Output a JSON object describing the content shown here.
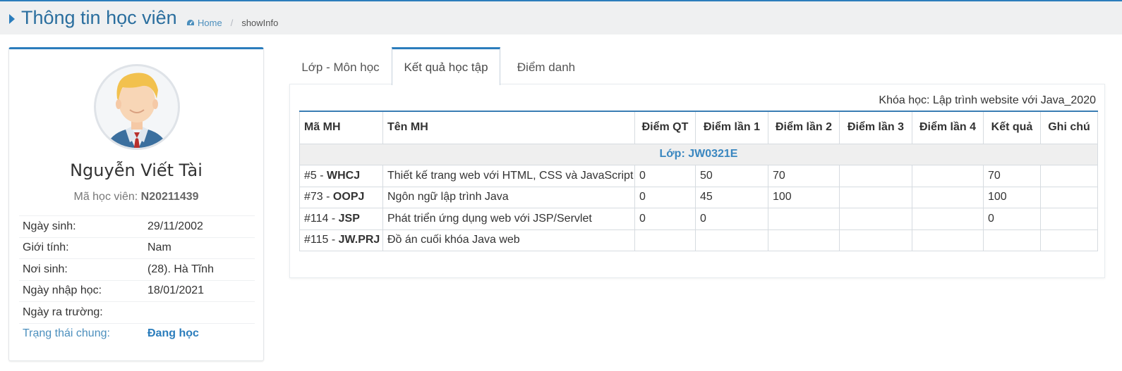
{
  "header": {
    "title": "Thông tin học viên",
    "breadcrumb_home": "Home",
    "breadcrumb_current": "showInfo"
  },
  "profile": {
    "name": "Nguyễn Viết Tài",
    "code_label": "Mã học viên:",
    "code_value": "N20211439",
    "fields": [
      {
        "label": "Ngày sinh:",
        "value": "29/11/2002"
      },
      {
        "label": "Giới tính:",
        "value": "Nam"
      },
      {
        "label": "Nơi sinh:",
        "value": "(28). Hà Tĩnh"
      },
      {
        "label": "Ngày nhập học:",
        "value": "18/01/2021"
      },
      {
        "label": "Ngày ra trường:",
        "value": ""
      },
      {
        "label": "Trạng thái chung:",
        "value": "Đang học"
      }
    ]
  },
  "tabs": [
    {
      "label": "Lớp - Môn học"
    },
    {
      "label": "Kết quả học tập"
    },
    {
      "label": "Điểm danh"
    }
  ],
  "course": "Khóa học: Lập trình website với Java_2020",
  "table": {
    "headers": [
      "Mã MH",
      "Tên MH",
      "Điểm QT",
      "Điểm lần 1",
      "Điểm lần 2",
      "Điểm lần 3",
      "Điểm lần 4",
      "Kết quả",
      "Ghi chú"
    ],
    "group": "Lớp: JW0321E",
    "rows": [
      {
        "id": "#5 - ",
        "code": "WHCJ",
        "name": "Thiết kế trang web với HTML, CSS và JavaScript",
        "qt": "0",
        "l1": "50",
        "l2": "70",
        "l3": "",
        "l4": "",
        "kq": "70",
        "note": ""
      },
      {
        "id": "#73 - ",
        "code": "OOPJ",
        "name": "Ngôn ngữ lập trình Java",
        "qt": "0",
        "l1": "45",
        "l2": "100",
        "l3": "",
        "l4": "",
        "kq": "100",
        "note": ""
      },
      {
        "id": "#114 - ",
        "code": "JSP",
        "name": "Phát triển ứng dụng web với JSP/Servlet",
        "qt": "0",
        "l1": "0",
        "l2": "",
        "l3": "",
        "l4": "",
        "kq": "0",
        "note": ""
      },
      {
        "id": "#115 - ",
        "code": "JW.PRJ",
        "name": "Đồ án cuối khóa Java web",
        "qt": "",
        "l1": "",
        "l2": "",
        "l3": "",
        "l4": "",
        "kq": "",
        "note": ""
      }
    ]
  },
  "colors": {
    "accent": "#2b7dbc",
    "title": "#2a6e9e",
    "group_text": "#3a87c0"
  }
}
